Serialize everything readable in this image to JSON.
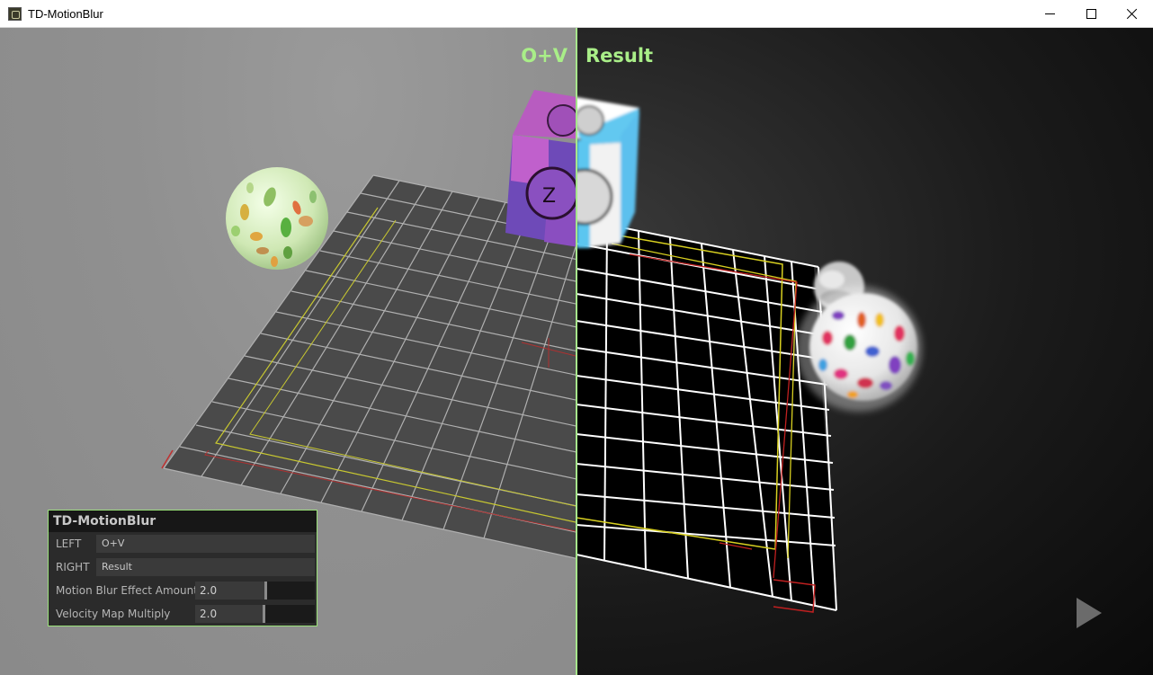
{
  "window": {
    "title": "TD-MotionBlur",
    "controls": {
      "minimize": "minimize",
      "maximize": "maximize",
      "close": "close"
    }
  },
  "viewport": {
    "left_label": "O+V",
    "right_label": "Result",
    "accent_color": "#a9ee88",
    "play_icon": "play-icon"
  },
  "panel": {
    "title": "TD-MotionBlur",
    "rows": [
      {
        "label": "LEFT",
        "value": "O+V"
      },
      {
        "label": "RIGHT",
        "value": "Result"
      }
    ],
    "sliders": [
      {
        "label": "Motion Blur Effect Amount",
        "value": "2.0",
        "level": 0.55
      },
      {
        "label": "Velocity Map Multiply",
        "value": "2.0",
        "level": 0.5
      }
    ]
  }
}
